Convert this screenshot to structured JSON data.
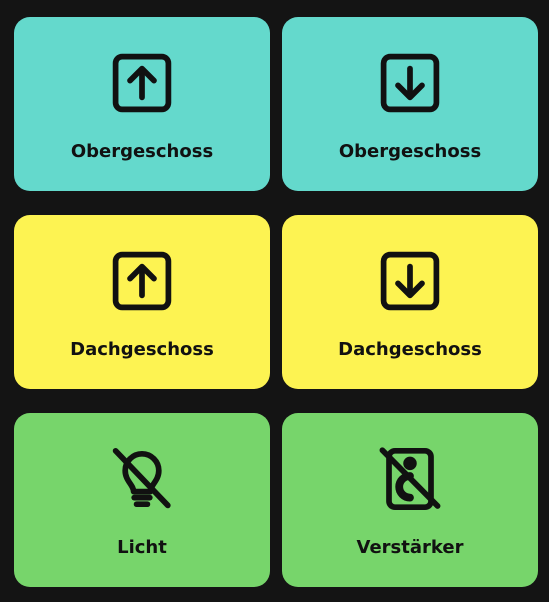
{
  "colors": {
    "background": "#141414",
    "obergeschoss": "#64d9cc",
    "dachgeschoss": "#fdf352",
    "misc": "#77d56b",
    "icon_and_text": "#111111"
  },
  "tiles": [
    {
      "label": "Obergeschoss",
      "icon": "arrow-up-box-icon"
    },
    {
      "label": "Obergeschoss",
      "icon": "arrow-down-box-icon"
    },
    {
      "label": "Dachgeschoss",
      "icon": "arrow-up-box-icon"
    },
    {
      "label": "Dachgeschoss",
      "icon": "arrow-down-box-icon"
    },
    {
      "label": "Licht",
      "icon": "lightbulb-off-icon"
    },
    {
      "label": "Verstärker",
      "icon": "speaker-off-icon"
    }
  ]
}
